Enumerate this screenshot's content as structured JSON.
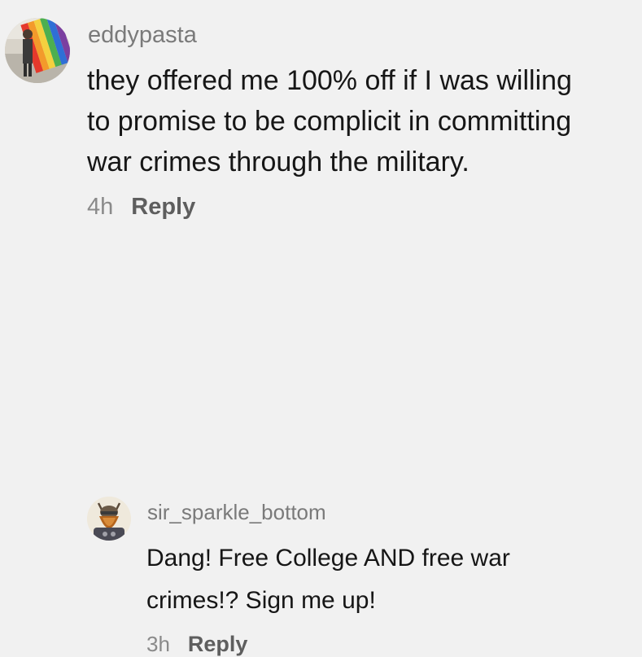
{
  "comments": [
    {
      "username": "eddypasta",
      "text": "they offered me 100% off if I was willing\nto promise to be complicit in committing\nwar crimes through the military.",
      "time": "4h",
      "reply_label": "Reply"
    },
    {
      "username": "sir_sparkle_bottom",
      "text": "Dang! Free College AND free war\ncrimes!? Sign me up!",
      "time": "3h",
      "reply_label": "Reply"
    }
  ]
}
